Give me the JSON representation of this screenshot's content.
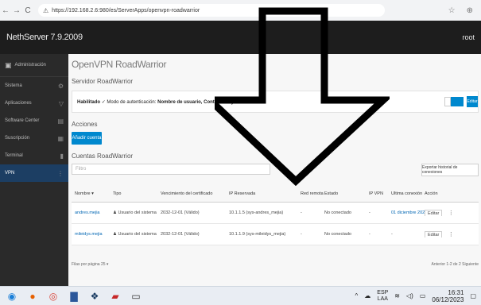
{
  "browser": {
    "url": "https://192.168.2.6:980/es/ServerApps/openvpn-roadwarrior",
    "nav": [
      "←",
      "→",
      "C"
    ]
  },
  "app": {
    "title": "NethServer 7.9.2009",
    "user": "root"
  },
  "sidebar": {
    "top_label": "Administración",
    "items": [
      {
        "label": "Sistema",
        "icon": "gear-icon"
      },
      {
        "label": "Aplicaciones",
        "icon": "filter-icon"
      },
      {
        "label": "Software Center",
        "icon": "cart-icon"
      },
      {
        "label": "Suscripción",
        "icon": "key-icon"
      },
      {
        "label": "Terminal",
        "icon": "terminal-icon"
      },
      {
        "label": "VPN",
        "icon": "lock-icon"
      }
    ]
  },
  "page": {
    "title": "OpenVPN RoadWarrior",
    "service_title": "Servidor RoadWarrior",
    "service_status": "Habilitado",
    "service_mode_prefix": "Modo de autenticación:",
    "service_mode": "Nombre de usuario, Contraseña y Certificado",
    "edit_label": "Editar",
    "actions_label": "Acciones",
    "add_button": "Añadir cuenta",
    "accounts_label": "Cuentas RoadWarrior",
    "filter_placeholder": "Filtro",
    "export_button": "Exportar historial de conexiones"
  },
  "table": {
    "headers": [
      "Nombre ▾",
      "Tipo",
      "Vencimiento del certificado",
      "IP Reservada",
      "Red remota",
      "Estado",
      "IP VPN",
      "Última conexión",
      "Acción"
    ],
    "rows": [
      {
        "name": "andres.mejia",
        "type": "Usuario del sistema",
        "expiry": "2032-12-01 (Válido)",
        "ip": "10.1.1.5 (sys-andres_mejia)",
        "remote": "-",
        "status": "No conectado",
        "vpn_ip": "-",
        "last": "01 diciembre 2022, 17:30",
        "action": "Editar"
      },
      {
        "name": "mileidys.mejia",
        "type": "Usuario del sistema",
        "expiry": "2032-12-01 (Válido)",
        "ip": "10.1.1.9 (sys-mileidys_mejia)",
        "remote": "-",
        "status": "No conectado",
        "vpn_ip": "-",
        "last": "-",
        "action": "Editar"
      }
    ]
  },
  "pager": {
    "per_page": "Filas por página  25 ▾",
    "range": "Anterior  1-2 de 2  Siguiente"
  },
  "taskbar": {
    "lang_top": "ESP",
    "lang_bottom": "LAA",
    "time": "16:31",
    "date": "06/12/2023"
  },
  "colors": {
    "accent": "#0088ce",
    "header_bg": "#1d1d1d",
    "sidebar_bg": "#2a2a2a"
  }
}
